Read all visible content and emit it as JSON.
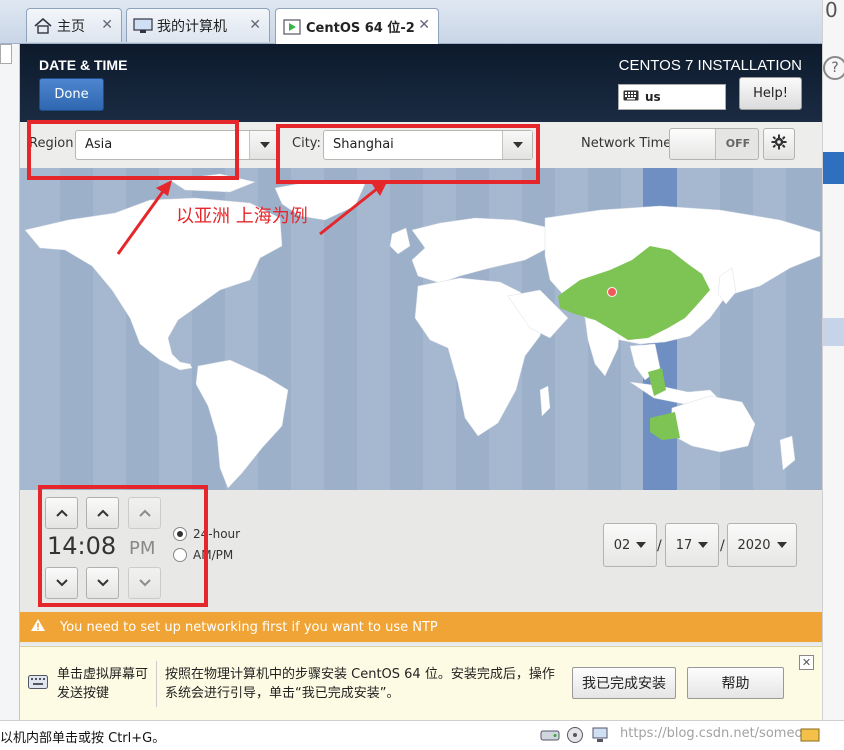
{
  "tabs": [
    {
      "label": "主页"
    },
    {
      "label": "我的计算机"
    },
    {
      "label": "CentOS 64 位-2"
    }
  ],
  "header": {
    "page_title": "DATE & TIME",
    "done_label": "Done",
    "product_title": "CENTOS 7 INSTALLATION",
    "keyboard_layout": "us",
    "help_label": "Help!"
  },
  "region": {
    "region_label": "Region:",
    "region_value": "Asia",
    "city_label": "City:",
    "city_value": "Shanghai",
    "network_time_label": "Network Time",
    "network_time_state": "OFF"
  },
  "annotation": {
    "text": "以亚洲 上海为例"
  },
  "time": {
    "hours": "14",
    "minutes": "08",
    "clock_text": "14:08",
    "ampm": "PM",
    "format_24": "24-hour",
    "format_ampm": "AM/PM",
    "selected_format": "24-hour"
  },
  "date": {
    "month": "02",
    "day": "17",
    "year": "2020",
    "separator": "/"
  },
  "warning": {
    "text": "You need to set up networking first if you want to use NTP"
  },
  "hint": {
    "left_text": "单击虚拟屏幕可发送按键",
    "main_text": "按照在物理计算机中的步骤安装 CentOS 64 位。安装完成后，操作系统会进行引导，单击“我已完成安装”。",
    "done_install_label": "我已完成安装",
    "help_label": "帮助"
  },
  "status": {
    "text": "以机内部单击或按 Ctrl+G。",
    "watermark": "https://blog.csdn.net/someone"
  },
  "colors": {
    "header_bg": "#0d1a2c",
    "done_blue": "#3a73bf",
    "warning_orange": "#f0a436",
    "selected_country": "#7dc454",
    "ocean": "#a6b8cf",
    "annotation_red": "#e5262b"
  }
}
